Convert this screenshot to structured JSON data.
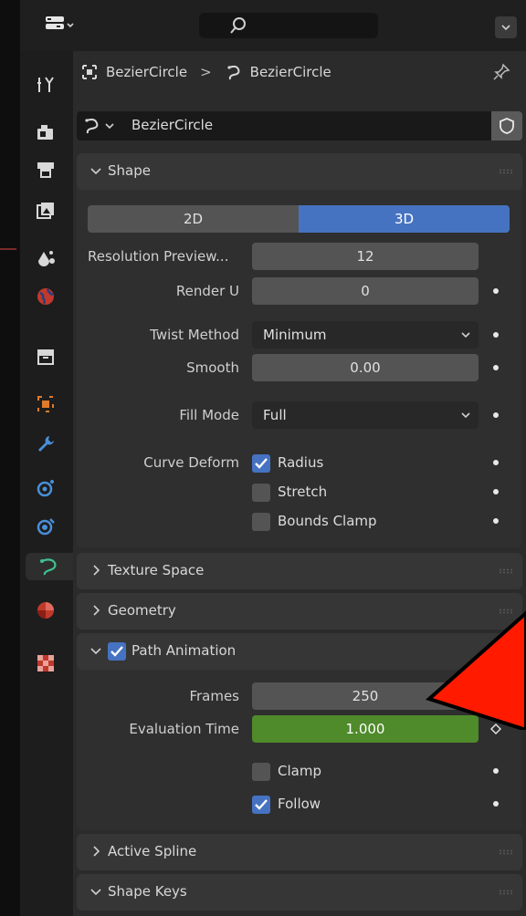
{
  "colors": {
    "accent_blue": "#4673c1",
    "anim_green": "#4f8a2b",
    "annotation_red": "#ff1a00",
    "panel_bg": "#2b2b2b"
  },
  "header": {
    "editor_icon": "properties-editor-icon",
    "search_icon": "search-icon",
    "dropdown_icon": "chevron-down-icon"
  },
  "tabs": [
    {
      "name": "tool-tab",
      "icon": "tool-icon"
    },
    {
      "name": "render-tab",
      "icon": "render-icon"
    },
    {
      "name": "output-tab",
      "icon": "output-icon"
    },
    {
      "name": "view-layer-tab",
      "icon": "view-layer-icon"
    },
    {
      "name": "scene-tab",
      "icon": "scene-icon"
    },
    {
      "name": "world-tab",
      "icon": "world-icon"
    },
    {
      "name": "collection-tab",
      "icon": "collection-icon"
    },
    {
      "name": "object-tab",
      "icon": "object-icon"
    },
    {
      "name": "modifier-tab",
      "icon": "wrench-icon"
    },
    {
      "name": "particles-tab",
      "icon": "particles-icon"
    },
    {
      "name": "physics-tab",
      "icon": "physics-icon"
    },
    {
      "name": "data-tab",
      "icon": "curve-data-icon",
      "active": true
    },
    {
      "name": "material-tab",
      "icon": "material-icon"
    },
    {
      "name": "texture-tab",
      "icon": "texture-icon"
    }
  ],
  "breadcrumb": {
    "object": "BezierCircle",
    "separator": ">",
    "data": "BezierCircle"
  },
  "datablock": {
    "name": "BezierCircle"
  },
  "shape": {
    "title": "Shape",
    "mode_2d": "2D",
    "mode_3d": "3D",
    "active_mode": "3D",
    "resolution_preview_label": "Resolution Preview...",
    "resolution_preview_value": "12",
    "render_u_label": "Render U",
    "render_u_value": "0",
    "twist_method_label": "Twist Method",
    "twist_method_value": "Minimum",
    "smooth_label": "Smooth",
    "smooth_value": "0.00",
    "fill_mode_label": "Fill Mode",
    "fill_mode_value": "Full",
    "curve_deform_label": "Curve Deform",
    "radius_label": "Radius",
    "radius_checked": true,
    "stretch_label": "Stretch",
    "stretch_checked": false,
    "bounds_clamp_label": "Bounds Clamp",
    "bounds_clamp_checked": false
  },
  "texture_space": {
    "title": "Texture Space"
  },
  "geometry": {
    "title": "Geometry"
  },
  "path_animation": {
    "title": "Path Animation",
    "enabled": true,
    "frames_label": "Frames",
    "frames_value": "250",
    "eval_time_label": "Evaluation Time",
    "eval_time_value": "1.000",
    "clamp_label": "Clamp",
    "clamp_checked": false,
    "follow_label": "Follow",
    "follow_checked": true
  },
  "active_spline": {
    "title": "Active Spline"
  },
  "shape_keys": {
    "title": "Shape Keys"
  }
}
